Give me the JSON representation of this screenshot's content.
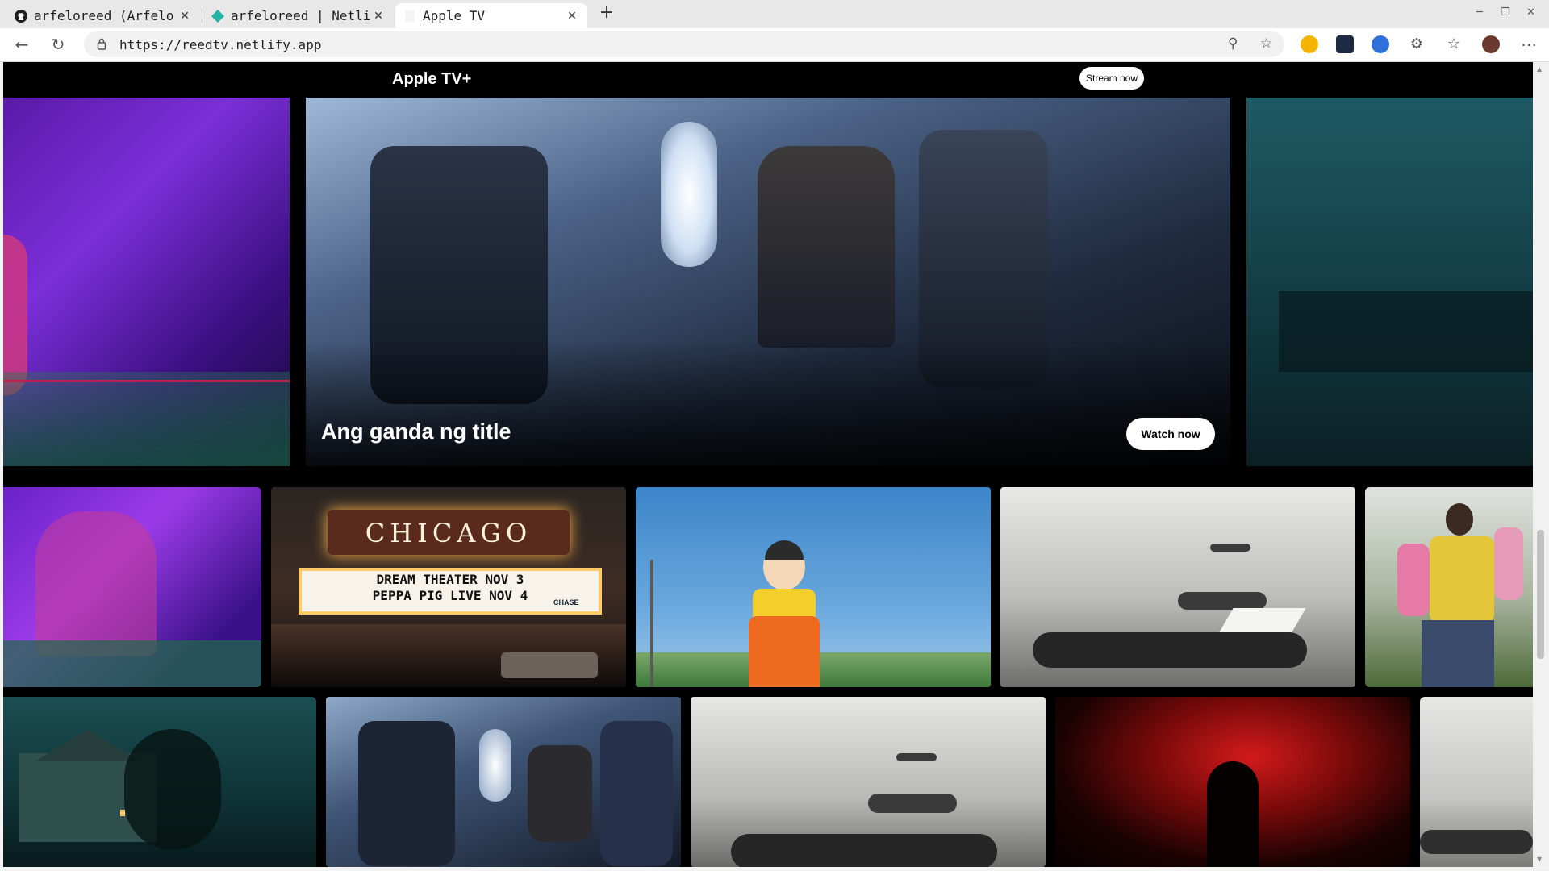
{
  "browser": {
    "tabs": [
      {
        "title": "arfeloreed (Arfelo R",
        "active": false
      },
      {
        "title": "arfeloreed | Netlify",
        "active": false
      },
      {
        "title": "Apple TV",
        "active": true
      }
    ],
    "url": "https://reedtv.netlify.app"
  },
  "site": {
    "logo": "Apple TV+",
    "stream_button": "Stream now",
    "hero": {
      "title": "Ang ganda ng title",
      "watch_button": "Watch now"
    },
    "chicago_marquee": {
      "sign": "CHICAGO",
      "line1": "DREAM THEATER NOV 3",
      "line2": "PEPPA PIG LIVE NOV 4",
      "sponsor": "CHASE"
    }
  },
  "colors": {
    "page_bg": "#000000",
    "button_bg": "#ffffff",
    "chrome_tabbar": "#e8e8e8"
  }
}
